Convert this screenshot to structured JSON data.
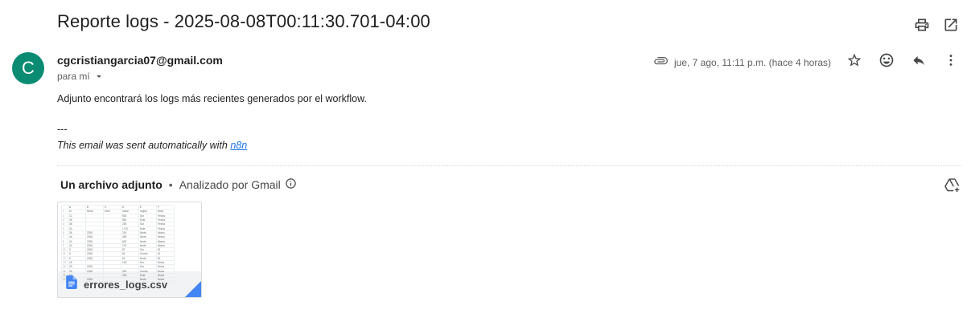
{
  "email": {
    "subject": "Reporte logs - 2025-08-08T00:11:30.701-04:00",
    "avatar_letter": "C",
    "avatar_color": "#0b8c72",
    "sender": "cgcristiangarcia07@gmail.com",
    "recipient_label": "para mí",
    "date": "jue, 7 ago, 11:11 p.m. (hace 4 horas)",
    "body_line1": "Adjunto encontrará los logs más recientes generados por el workflow.",
    "separator_text": "---",
    "footer_text": "This email was sent automatically with ",
    "footer_link": "n8n",
    "link_color": "#1a73e8"
  },
  "attachments": {
    "header": "Un archivo adjunto",
    "bullet": "•",
    "scan_status": "Analizado por Gmail",
    "file": {
      "name": "errores_logs.csv",
      "icon": "google-docs-icon",
      "icon_color": "#4285f4"
    }
  },
  "icons": {
    "print": "print-icon",
    "open_new_window": "open-in-new-window-icon",
    "attachment": "paperclip-icon",
    "star": "star-icon",
    "emoji": "emoji-reaction-icon",
    "reply": "reply-icon",
    "more": "more-vertical-icon",
    "info": "info-icon",
    "drive_add": "add-to-drive-icon"
  }
}
